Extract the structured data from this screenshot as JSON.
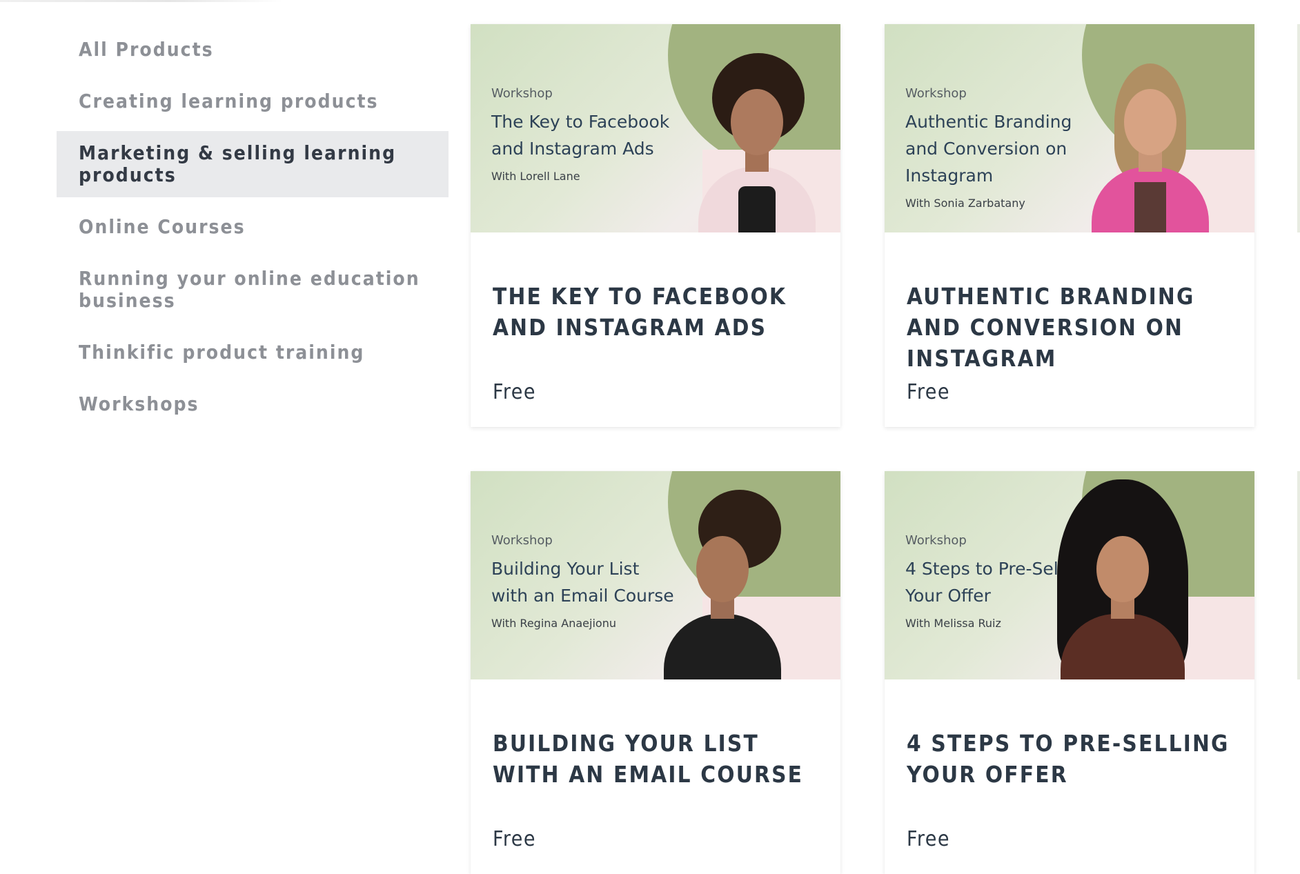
{
  "sidebar": {
    "categories": [
      {
        "label": "All Products"
      },
      {
        "label": "Creating learning products"
      },
      {
        "label": "Marketing & selling learning products",
        "active": true
      },
      {
        "label": "Online Courses"
      },
      {
        "label": "Running your online education business"
      },
      {
        "label": "Thinkific product training"
      },
      {
        "label": "Workshops"
      }
    ]
  },
  "products": [
    {
      "banner_eyebrow": "Workshop",
      "banner_title": "The Key to Facebook and Instagram Ads",
      "banner_byline": "With Lorell Lane",
      "title": "THE KEY TO FACEBOOK AND INSTAGRAM ADS",
      "price": "Free"
    },
    {
      "banner_eyebrow": "Workshop",
      "banner_title": "Authentic Branding and Conversion on Instagram",
      "banner_byline": "With Sonia Zarbatany",
      "title": "AUTHENTIC BRANDING AND CONVERSION ON INSTAGRAM",
      "price": "Free"
    },
    {
      "banner_eyebrow": "Workshop",
      "banner_title": "Building Your List with an Email Course",
      "banner_byline": "With Regina Anaejionu",
      "title": "BUILDING YOUR LIST WITH AN EMAIL COURSE",
      "price": "Free"
    },
    {
      "banner_eyebrow": "Workshop",
      "banner_title": "4 Steps to Pre-Selling Your Offer",
      "banner_byline": "With Melissa Ruiz",
      "title": "4 STEPS TO PRE-SELLING YOUR OFFER",
      "price": "Free"
    }
  ],
  "colors": {
    "active_bg": "#e9eaec",
    "inactive_text": "#8d9096",
    "active_text": "#333a45",
    "banner_green": "#a2b380",
    "title_text": "#2c3845"
  }
}
